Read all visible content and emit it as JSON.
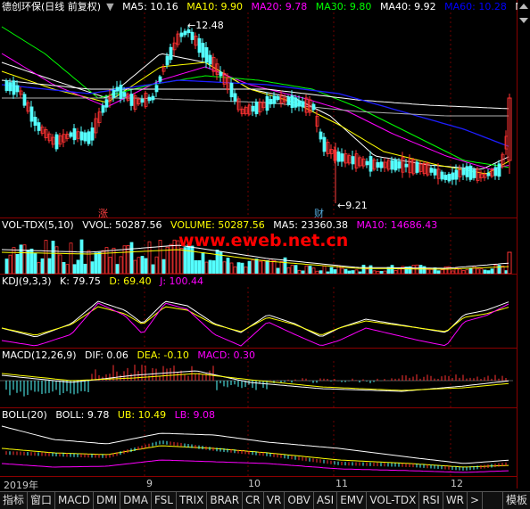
{
  "main": {
    "title": "德创环保(日线 前复权)",
    "ma": [
      {
        "label": "MA5: 10.16",
        "color": "#ffffff"
      },
      {
        "label": "MA10: 9.90",
        "color": "#ffff00"
      },
      {
        "label": "MA20: 9.78",
        "color": "#ff00ff"
      },
      {
        "label": "MA30: 9.80",
        "color": "#00ff00"
      },
      {
        "label": "MA40: 9.92",
        "color": "#ffffff"
      },
      {
        "label": "MA60: 10.28",
        "color": "#0000ff"
      },
      {
        "label": "MA",
        "color": "#ffffff"
      }
    ],
    "high_label": "12.48",
    "low_label": "9.21",
    "mark_zhang": "涨",
    "mark_cai": "财"
  },
  "vol": {
    "title": "VOL-TDX(5,10)",
    "vvol": "VVOL: 50287.56",
    "volume": "VOLUME: 50287.56",
    "ma5": "MA5: 23360.38",
    "ma10": "MA10: 14686.43"
  },
  "kdj": {
    "title": "KDJ(9,3,3)",
    "k": "K: 79.75",
    "d": "D: 69.40",
    "j": "J: 100.44"
  },
  "macd": {
    "title": "MACD(12,26,9)",
    "dif": "DIF: 0.06",
    "dea": "DEA: -0.10",
    "macd": "MACD: 0.30"
  },
  "boll": {
    "title": "BOLL(20)",
    "boll": "BOLL: 9.78",
    "ub": "UB: 10.49",
    "lb": "LB: 9.08"
  },
  "watermark": "www.eweb.net.cn",
  "dates": [
    "2019年",
    "9",
    "10",
    "11",
    "12"
  ],
  "tabs": [
    "指标",
    "窗口",
    "MACD",
    "DMI",
    "DMA",
    "FSL",
    "TRIX",
    "BRAR",
    "CR",
    "VR",
    "OBV",
    "ASI",
    "EMV",
    "VOL-TDX",
    "RSI",
    "WR"
  ],
  "tab_more": ">",
  "tab_template": "模板",
  "colors": {
    "up": "#ff3232",
    "down": "#54ffff",
    "border": "#8b0000"
  }
}
